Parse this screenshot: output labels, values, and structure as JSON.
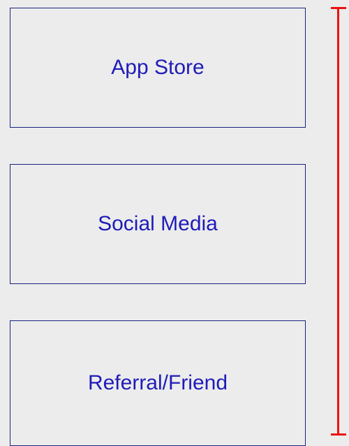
{
  "options": [
    {
      "label": "App Store"
    },
    {
      "label": "Social Media"
    },
    {
      "label": "Referral/Friend"
    }
  ],
  "colors": {
    "background": "#ececec",
    "border": "#1a237e",
    "text": "#1f1bb8",
    "indicator": "#ee1111"
  }
}
